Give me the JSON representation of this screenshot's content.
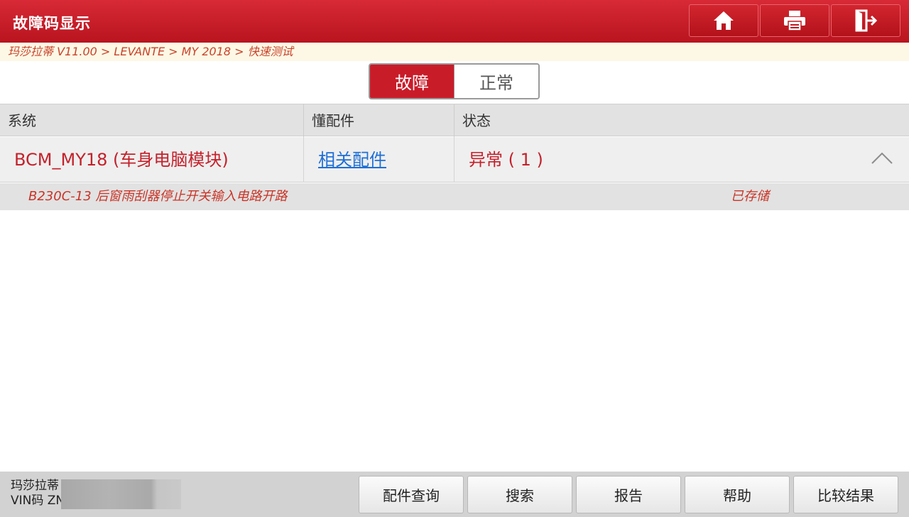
{
  "header": {
    "title": "故障码显示",
    "buttons": [
      {
        "icon": "home-icon"
      },
      {
        "icon": "printer-icon"
      },
      {
        "icon": "exit-icon"
      }
    ]
  },
  "breadcrumb": "玛莎拉蒂 V11.00 > LEVANTE > MY 2018 > 快速测试",
  "toggle": {
    "active": "故障",
    "inactive": "正常"
  },
  "table": {
    "headers": [
      "系统",
      "懂配件",
      "状态"
    ],
    "rows": [
      {
        "system": "BCM_MY18 (车身电脑模块)",
        "parts_link": "相关配件",
        "status": "异常 ( 1 )",
        "expanded": true,
        "faults": [
          {
            "code_desc": "B230C-13 后窗雨刮器停止开关输入电路开路",
            "state": "已存储"
          }
        ]
      }
    ]
  },
  "footer": {
    "vehicle_line1": "玛莎拉蒂",
    "vehicle_line2": "VIN码 ZN",
    "buttons": [
      "配件查询",
      "搜索",
      "报告",
      "帮助",
      "比较结果"
    ]
  },
  "colors": {
    "brand_red": "#c91c29",
    "link_blue": "#1e6fd6",
    "fault_text": "#c93427"
  }
}
